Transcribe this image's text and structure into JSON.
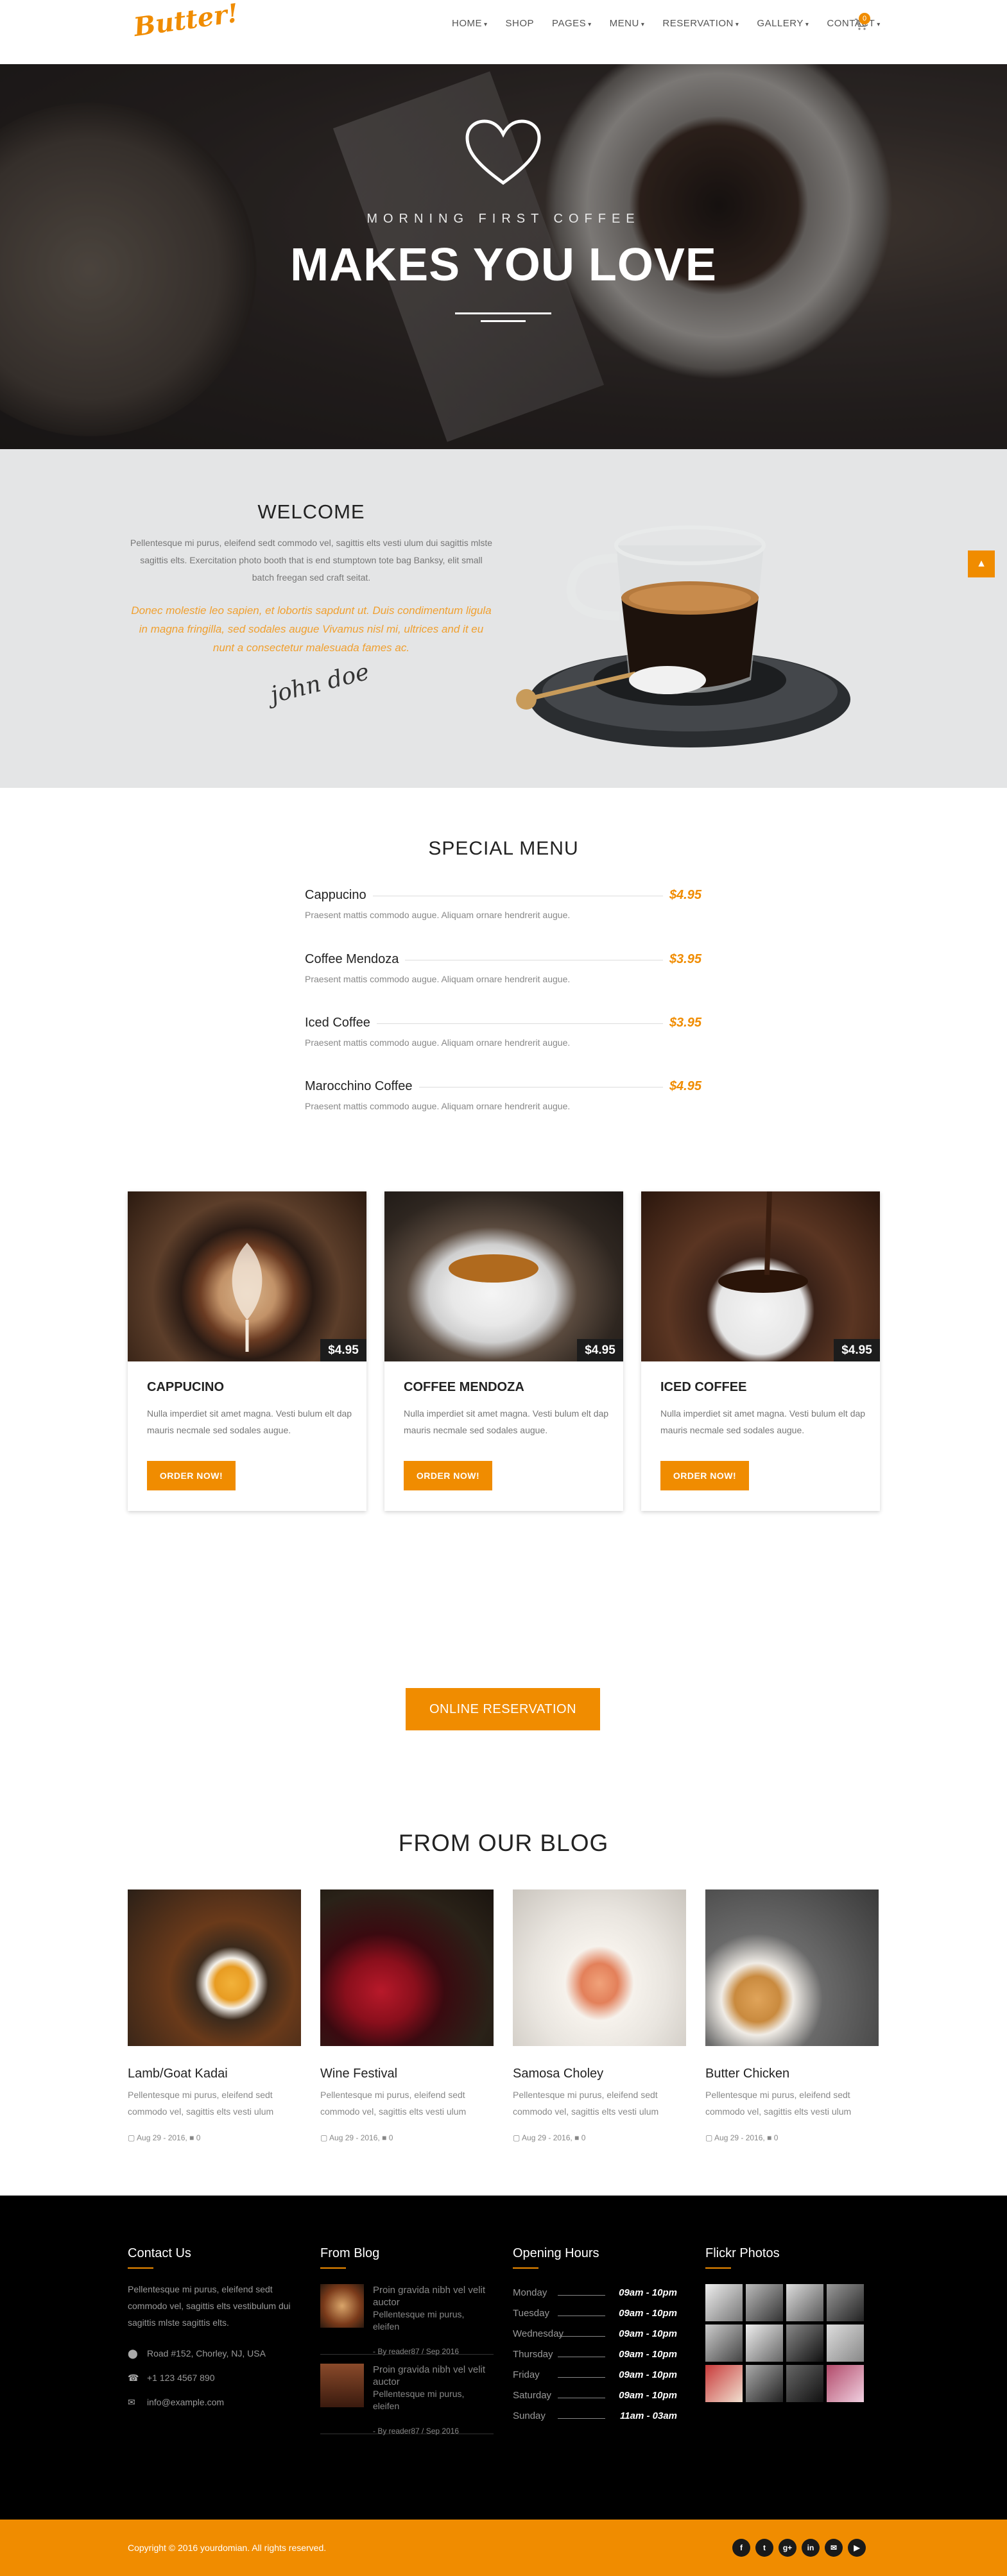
{
  "header": {
    "logo": "Butter!",
    "nav": [
      {
        "label": "HOME",
        "dropdown": true
      },
      {
        "label": "SHOP",
        "dropdown": false
      },
      {
        "label": "PAGES",
        "dropdown": true
      },
      {
        "label": "MENU",
        "dropdown": true
      },
      {
        "label": "RESERVATION",
        "dropdown": true
      },
      {
        "label": "GALLERY",
        "dropdown": true
      },
      {
        "label": "CONTACT",
        "dropdown": true
      }
    ],
    "cart_count": "0",
    "accent": "#f08c00"
  },
  "hero": {
    "subtitle": "MORNING FIRST COFFEE",
    "title": "MAKES YOU LOVE"
  },
  "welcome": {
    "title": "WELCOME",
    "text": "Pellentesque mi purus, eleifend sedt commodo vel, sagittis elts vesti ulum dui sagittis mlste sagittis elts. Exercitation photo booth that is end stumptown tote bag Banksy, elit small batch freegan sed craft seitat.",
    "italic": "Donec molestie leo sapien, et lobortis sapdunt ut. Duis condimentum ligula in magna fringilla, sed sodales augue Vivamus nisl mi, ultrices and it eu nunt a consectetur malesuada fames ac.",
    "signature": "john doe"
  },
  "special_menu": {
    "title": "SPECIAL MENU",
    "items": [
      {
        "name": "Cappucino",
        "price": "$4.95",
        "desc": "Praesent mattis commodo augue. Aliquam ornare hendrerit augue."
      },
      {
        "name": "Coffee Mendoza",
        "price": "$3.95",
        "desc": "Praesent mattis commodo augue. Aliquam ornare hendrerit augue."
      },
      {
        "name": "Iced Coffee",
        "price": "$3.95",
        "desc": "Praesent mattis commodo augue. Aliquam ornare hendrerit augue."
      },
      {
        "name": "Marocchino Coffee",
        "price": "$4.95",
        "desc": "Praesent mattis commodo augue. Aliquam ornare hendrerit augue."
      }
    ]
  },
  "products": [
    {
      "title": "CAPPUCINO",
      "price": "$4.95",
      "desc": "Nulla imperdiet sit amet magna. Vesti bulum elt dap mauris necmale sed sodales augue.",
      "button": "ORDER NOW!"
    },
    {
      "title": "COFFEE MENDOZA",
      "price": "$4.95",
      "desc": "Nulla imperdiet sit amet magna. Vesti bulum elt dap mauris necmale sed sodales augue.",
      "button": "ORDER NOW!"
    },
    {
      "title": "ICED COFFEE",
      "price": "$4.95",
      "desc": "Nulla imperdiet sit amet magna. Vesti bulum elt dap mauris necmale sed sodales augue.",
      "button": "ORDER NOW!"
    }
  ],
  "reservation": {
    "button": "ONLINE RESERVATION"
  },
  "blog": {
    "title": "FROM OUR BLOG",
    "posts": [
      {
        "title": "Lamb/Goat Kadai",
        "desc": "Pellentesque mi purus, eleifend sedt commodo vel, sagittis elts vesti ulum",
        "date": "Aug 29 - 2016,",
        "comments": "0"
      },
      {
        "title": "Wine Festival",
        "desc": "Pellentesque mi purus, eleifend sedt commodo vel, sagittis elts vesti ulum",
        "date": "Aug 29 - 2016,",
        "comments": "0"
      },
      {
        "title": "Samosa Choley",
        "desc": "Pellentesque mi purus, eleifend sedt commodo vel, sagittis elts vesti ulum",
        "date": "Aug 29 - 2016,",
        "comments": "0"
      },
      {
        "title": "Butter Chicken",
        "desc": "Pellentesque mi purus, eleifend sedt commodo vel, sagittis elts vesti ulum",
        "date": "Aug 29 - 2016,",
        "comments": "0"
      }
    ]
  },
  "footer": {
    "contact": {
      "title": "Contact Us",
      "text": "Pellentesque mi purus, eleifend sedt commodo vel, sagittis elts vestibulum dui sagittis mlste sagittis elts.",
      "address": "Road #152, Chorley, NJ, USA",
      "phone": "+1 123 4567 890",
      "email": "info@example.com"
    },
    "from_blog": {
      "title": "From Blog",
      "posts": [
        {
          "title": "Proin gravida nibh vel velit auctor",
          "desc": "Pellentesque mi purus, eleifen",
          "meta": "- By reader87 / Sep 2016"
        },
        {
          "title": "Proin gravida nibh vel velit auctor",
          "desc": "Pellentesque mi purus, eleifen",
          "meta": "- By reader87 / Sep 2016"
        }
      ]
    },
    "hours": {
      "title": "Opening Hours",
      "rows": [
        {
          "day": "Monday",
          "time": "09am - 10pm"
        },
        {
          "day": "Tuesday",
          "time": "09am - 10pm"
        },
        {
          "day": "Wednesday",
          "time": "09am - 10pm"
        },
        {
          "day": "Thursday",
          "time": "09am - 10pm"
        },
        {
          "day": "Friday",
          "time": "09am - 10pm"
        },
        {
          "day": "Saturday",
          "time": "09am - 10pm"
        },
        {
          "day": "Sunday",
          "time": "11am - 03am"
        }
      ]
    },
    "flickr": {
      "title": "Flickr Photos"
    },
    "copyright": "Copyright © 2016 yourdomian. All rights reserved.",
    "social": [
      "f",
      "t",
      "g+",
      "in",
      "✉",
      "▶"
    ]
  }
}
